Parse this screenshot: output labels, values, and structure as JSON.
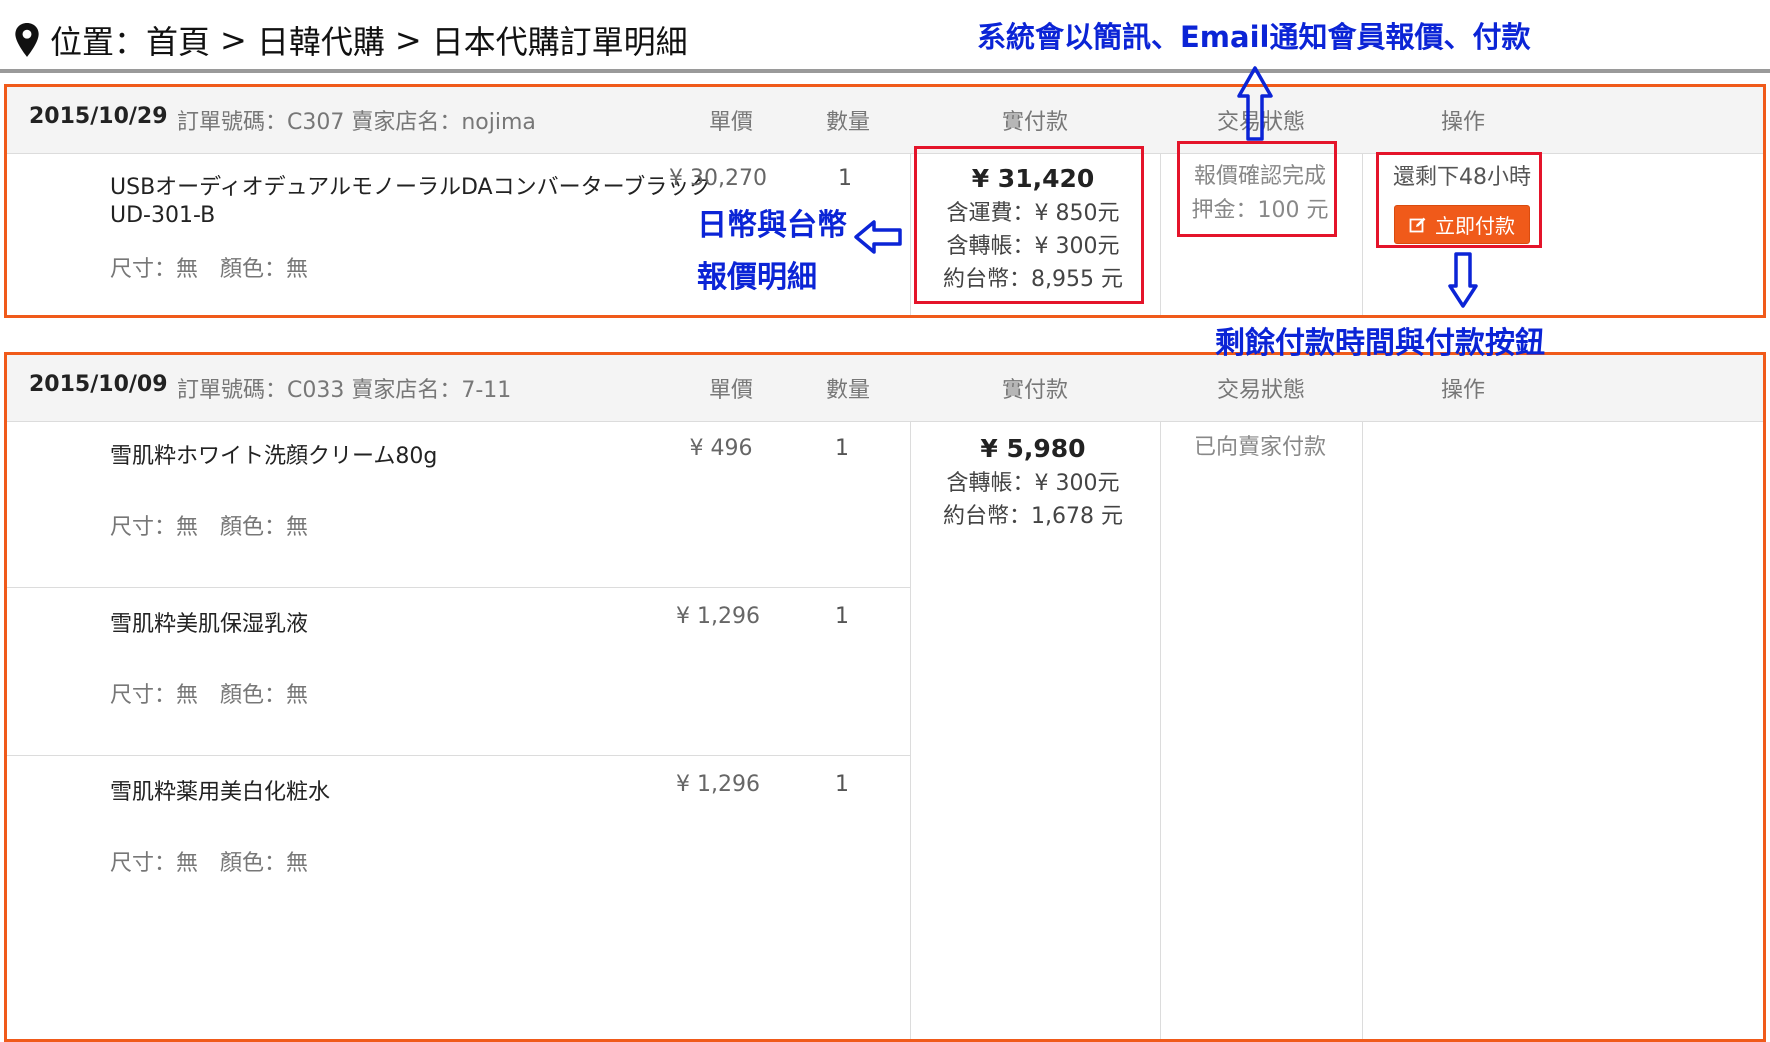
{
  "breadcrumb": {
    "location_label": "位置：首頁",
    "sep_1": ">",
    "item_2": "日韓代購",
    "sep_2": ">",
    "item_3": "日本代購訂單明細"
  },
  "annotations": {
    "notify": "系統會以簡訊、Email通知會員報價、付款",
    "currency_line1": "日幣與台幣",
    "currency_line2": "報價明細",
    "remaining": "剩餘付款時間與付款按鈕"
  },
  "columns": {
    "unit_price": "單價",
    "quantity": "數量",
    "actual_payment": "實付款",
    "status": "交易狀態",
    "operation": "操作"
  },
  "orders": [
    {
      "date": "2015/10/29",
      "meta": "訂單號碼：C307 賣家店名：nojima",
      "items": [
        {
          "name_line1": "USBオーディオデュアルモノーラルDAコンバーターブラック",
          "name_line2": "UD-301-B",
          "attrs": "尺寸：無　顏色：無",
          "price": "¥ 30,270",
          "qty": "1"
        }
      ],
      "payment": {
        "total": "¥ 31,420",
        "line1": "含運費：¥ 850元",
        "line2": "含轉帳：¥ 300元",
        "line3": "約台幣：8,955 元"
      },
      "status_line1": "報價確認完成",
      "status_line2": "押金：100 元",
      "op_text": "還剩下48小時",
      "pay_button": "立即付款"
    },
    {
      "date": "2015/10/09",
      "meta": "訂單號碼：C033 賣家店名：7-11",
      "items": [
        {
          "name_line1": "雪肌粋ホワイト洗顔クリーム80g",
          "attrs": "尺寸：無　顏色：無",
          "price": "¥ 496",
          "qty": "1"
        },
        {
          "name_line1": "雪肌粋美肌保湿乳液",
          "attrs": "尺寸：無　顏色：無",
          "price": "¥ 1,296",
          "qty": "1"
        },
        {
          "name_line1": "雪肌粋薬用美白化粧水",
          "attrs": "尺寸：無　顏色：無",
          "price": "¥ 1,296",
          "qty": "1"
        }
      ],
      "payment": {
        "total": "¥ 5,980",
        "line1": "含轉帳：¥ 300元",
        "line2": "約台幣：1,678 元"
      },
      "status_line1": "已向賣家付款"
    }
  ],
  "colors": {
    "panel_border": "#f05a1a",
    "highlight_box": "#e4142a",
    "annotation_blue": "#0b24d6",
    "pay_button": "#f05a1a"
  },
  "icons": [
    "map-pin-icon",
    "arrow-up-icon",
    "arrow-left-icon",
    "arrow-down-icon",
    "edit-icon"
  ]
}
